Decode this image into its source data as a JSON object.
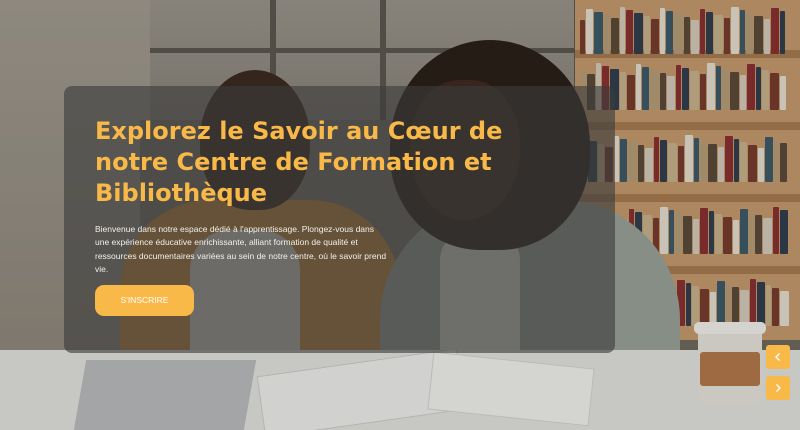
{
  "hero": {
    "title": "Explorez le Savoir au Cœur de notre Centre de Formation et Bibliothèque",
    "description": "Bienvenue dans notre espace dédié à l'apprentissage. Plongez-vous dans une expérience éducative enrichissante, alliant formation de qualité et ressources documentaires variées au sein de notre centre, où le savoir prend vie.",
    "cta_label": "S'INSCRIRE"
  },
  "slider": {
    "prev_icon": "chevron-left-icon",
    "next_icon": "chevron-right-icon"
  },
  "colors": {
    "accent": "#f9b949",
    "card_overlay": "rgba(60, 60, 60, 0.62)",
    "text_light": "#f3f0ea"
  }
}
